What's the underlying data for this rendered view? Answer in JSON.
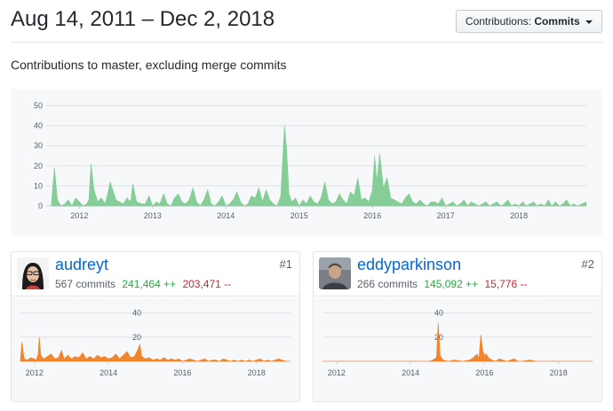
{
  "header": {
    "date_range": "Aug 14, 2011 – Dec 2, 2018",
    "contributions_label": "Contributions:",
    "contributions_value": "Commits"
  },
  "subtitle": "Contributions to master, excluding merge commits",
  "colors": {
    "main_area": "#7fcb92",
    "contributor_area": "#f17f22",
    "link": "#0366d6",
    "additions": "#28a745",
    "deletions": "#cb2431"
  },
  "contributors": [
    {
      "username": "audreyt",
      "commits": "567 commits",
      "additions": "241,464 ++",
      "deletions": "203,471 --",
      "rank": "#1"
    },
    {
      "username": "eddyparkinson",
      "commits": "266 commits",
      "additions": "145,092 ++",
      "deletions": "15,776 --",
      "rank": "#2"
    }
  ],
  "chart_data": [
    {
      "type": "area",
      "title": "",
      "x_tick_labels": [
        "2012",
        "2013",
        "2014",
        "2015",
        "2016",
        "2017",
        "2018"
      ],
      "y_tick_labels": [
        "0",
        "10",
        "20",
        "30",
        "40",
        "50"
      ],
      "ylim": [
        0,
        50
      ],
      "xlim": [
        2011.62,
        2018.92
      ],
      "grid": true,
      "x": [
        2011.62,
        2011.66,
        2011.7,
        2011.75,
        2011.8,
        2011.85,
        2011.9,
        2011.95,
        2012.0,
        2012.05,
        2012.1,
        2012.13,
        2012.16,
        2012.2,
        2012.25,
        2012.3,
        2012.35,
        2012.38,
        2012.42,
        2012.5,
        2012.55,
        2012.6,
        2012.65,
        2012.7,
        2012.73,
        2012.78,
        2012.85,
        2012.9,
        2012.95,
        2013.0,
        2013.05,
        2013.1,
        2013.15,
        2013.2,
        2013.25,
        2013.3,
        2013.35,
        2013.4,
        2013.45,
        2013.5,
        2013.55,
        2013.6,
        2013.65,
        2013.7,
        2013.75,
        2013.8,
        2013.85,
        2013.9,
        2013.95,
        2014.0,
        2014.05,
        2014.1,
        2014.15,
        2014.2,
        2014.25,
        2014.3,
        2014.35,
        2014.4,
        2014.45,
        2014.5,
        2014.55,
        2014.6,
        2014.65,
        2014.7,
        2014.75,
        2014.8,
        2014.83,
        2014.86,
        2014.9,
        2014.95,
        2015.0,
        2015.05,
        2015.1,
        2015.15,
        2015.2,
        2015.25,
        2015.3,
        2015.35,
        2015.4,
        2015.45,
        2015.5,
        2015.55,
        2015.6,
        2015.65,
        2015.7,
        2015.75,
        2015.8,
        2015.85,
        2015.9,
        2015.95,
        2016.0,
        2016.03,
        2016.06,
        2016.1,
        2016.15,
        2016.2,
        2016.25,
        2016.3,
        2016.35,
        2016.4,
        2016.45,
        2016.5,
        2016.55,
        2016.6,
        2016.65,
        2016.7,
        2016.75,
        2016.8,
        2016.85,
        2016.9,
        2016.95,
        2017.0,
        2017.05,
        2017.1,
        2017.15,
        2017.2,
        2017.25,
        2017.3,
        2017.35,
        2017.4,
        2017.45,
        2017.5,
        2017.55,
        2017.6,
        2017.65,
        2017.7,
        2017.75,
        2017.8,
        2017.85,
        2017.9,
        2017.95,
        2018.0,
        2018.05,
        2018.1,
        2018.15,
        2018.2,
        2018.25,
        2018.3,
        2018.35,
        2018.4,
        2018.45,
        2018.5,
        2018.55,
        2018.6,
        2018.65,
        2018.7,
        2018.75,
        2018.8,
        2018.92
      ],
      "y": [
        2,
        19,
        3,
        0,
        1,
        3,
        0,
        4,
        2,
        0,
        1,
        3,
        21,
        8,
        2,
        4,
        1,
        5,
        12,
        3,
        2,
        1,
        4,
        2,
        11,
        2,
        1,
        1,
        5,
        0,
        2,
        1,
        6,
        1,
        0,
        4,
        6,
        2,
        1,
        3,
        9,
        2,
        0,
        3,
        8,
        1,
        0,
        2,
        5,
        0,
        1,
        3,
        7,
        2,
        0,
        1,
        5,
        4,
        9,
        2,
        8,
        3,
        1,
        0,
        5,
        40,
        28,
        6,
        2,
        4,
        0,
        3,
        1,
        5,
        2,
        1,
        4,
        12,
        3,
        1,
        2,
        6,
        3,
        1,
        7,
        5,
        14,
        3,
        4,
        2,
        8,
        25,
        12,
        26,
        9,
        14,
        4,
        3,
        2,
        1,
        4,
        6,
        2,
        1,
        3,
        1,
        0,
        2,
        2,
        1,
        4,
        0,
        1,
        2,
        0,
        1,
        3,
        0,
        2,
        1,
        0,
        1,
        2,
        0,
        1,
        2,
        0,
        1,
        3,
        0,
        1,
        0,
        2,
        0,
        1,
        2,
        0,
        1,
        0,
        3,
        0,
        2,
        0,
        1,
        3,
        0,
        1,
        0,
        2,
        0,
        0
      ]
    },
    {
      "type": "area",
      "title": "",
      "series": [
        {
          "name": "audreyt"
        }
      ],
      "x_tick_labels": [
        "2012",
        "2014",
        "2016",
        "2018"
      ],
      "y_tick_labels": [
        "20",
        "40"
      ],
      "ylim": [
        0,
        50
      ],
      "xlim": [
        2011.62,
        2018.92
      ],
      "grid": true,
      "x": [
        2011.62,
        2011.66,
        2011.72,
        2011.8,
        2011.9,
        2012.0,
        2012.05,
        2012.1,
        2012.13,
        2012.17,
        2012.25,
        2012.35,
        2012.45,
        2012.55,
        2012.65,
        2012.73,
        2012.8,
        2012.9,
        2013.0,
        2013.1,
        2013.2,
        2013.3,
        2013.4,
        2013.5,
        2013.6,
        2013.7,
        2013.8,
        2013.9,
        2014.0,
        2014.1,
        2014.2,
        2014.3,
        2014.4,
        2014.5,
        2014.6,
        2014.7,
        2014.8,
        2014.85,
        2014.9,
        2015.0,
        2015.1,
        2015.2,
        2015.3,
        2015.4,
        2015.5,
        2015.6,
        2015.7,
        2015.8,
        2015.9,
        2016.0,
        2016.1,
        2016.2,
        2016.3,
        2016.4,
        2016.5,
        2016.6,
        2016.7,
        2016.8,
        2016.9,
        2017.0,
        2017.1,
        2017.2,
        2017.3,
        2017.4,
        2017.5,
        2017.6,
        2017.7,
        2017.8,
        2017.9,
        2018.0,
        2018.1,
        2018.2,
        2018.3,
        2018.4,
        2018.5,
        2018.6,
        2018.7,
        2018.8,
        2018.92
      ],
      "y": [
        1,
        16,
        2,
        1,
        3,
        2,
        1,
        6,
        20,
        5,
        2,
        4,
        6,
        2,
        3,
        9,
        2,
        5,
        2,
        4,
        3,
        7,
        2,
        4,
        2,
        5,
        3,
        4,
        2,
        3,
        6,
        2,
        5,
        8,
        3,
        4,
        10,
        14,
        4,
        2,
        3,
        1,
        2,
        1,
        3,
        1,
        2,
        1,
        2,
        0,
        1,
        2,
        1,
        0,
        1,
        2,
        0,
        1,
        1,
        0,
        2,
        1,
        0,
        1,
        0,
        1,
        0,
        1,
        0,
        1,
        2,
        0,
        1,
        0,
        1,
        2,
        1,
        0,
        0
      ]
    },
    {
      "type": "area",
      "title": "",
      "series": [
        {
          "name": "eddyparkinson"
        }
      ],
      "x_tick_labels": [
        "2012",
        "2014",
        "2016",
        "2018"
      ],
      "y_tick_labels": [
        "20",
        "40"
      ],
      "ylim": [
        0,
        50
      ],
      "xlim": [
        2011.62,
        2018.92
      ],
      "grid": true,
      "x": [
        2011.62,
        2014.5,
        2014.6,
        2014.7,
        2014.75,
        2014.8,
        2014.85,
        2014.9,
        2015.0,
        2015.2,
        2015.4,
        2015.6,
        2015.7,
        2015.8,
        2015.85,
        2015.9,
        2015.95,
        2016.0,
        2016.05,
        2016.1,
        2016.15,
        2016.2,
        2016.3,
        2016.4,
        2016.5,
        2016.6,
        2016.7,
        2016.8,
        2016.9,
        2017.0,
        2017.2,
        2017.4,
        2017.6,
        2017.8,
        2018.0,
        2018.2,
        2018.4,
        2018.6,
        2018.92
      ],
      "y": [
        0,
        0,
        1,
        3,
        32,
        5,
        2,
        1,
        0,
        1,
        0,
        1,
        3,
        6,
        2,
        22,
        9,
        5,
        6,
        3,
        2,
        1,
        0,
        2,
        1,
        0,
        1,
        2,
        0,
        0,
        1,
        0,
        0,
        0,
        0,
        0,
        0,
        0,
        0
      ]
    }
  ]
}
